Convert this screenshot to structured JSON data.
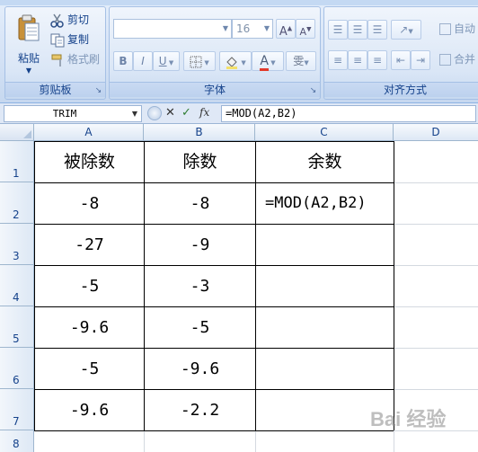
{
  "ribbon": {
    "clipboard": {
      "group_label": "剪贴板",
      "paste": "粘贴",
      "cut": "剪切",
      "copy": "复制",
      "format_painter": "格式刷"
    },
    "font": {
      "group_label": "字体",
      "font_name": "",
      "font_size": "16",
      "bold": "B",
      "italic": "I",
      "underline": "U",
      "font_color_glyph": "A",
      "phonetic_glyph": "雯"
    },
    "alignment": {
      "group_label": "对齐方式",
      "wrap_text": "自动",
      "merge_center": "合并"
    }
  },
  "formula_bar": {
    "name_box": "TRIM",
    "cancel": "✕",
    "enter": "✓",
    "fx": "fx",
    "formula": "=MOD(A2,B2)"
  },
  "grid": {
    "columns": [
      "A",
      "B",
      "C",
      "D"
    ],
    "rows": [
      "1",
      "2",
      "3",
      "4",
      "5",
      "6",
      "7",
      "8"
    ],
    "cells": [
      [
        "被除数",
        "除数",
        "余数"
      ],
      [
        "-8",
        "-8",
        "=MOD(A2,B2)"
      ],
      [
        "-27",
        "-9",
        ""
      ],
      [
        "-5",
        "-3",
        ""
      ],
      [
        "-9.6",
        "-5",
        ""
      ],
      [
        "-5",
        "-9.6",
        ""
      ],
      [
        "-9.6",
        "-2.2",
        ""
      ]
    ]
  },
  "watermark": {
    "text": "Bai 经验",
    "icon": "baidu-paw-icon"
  },
  "colors": {
    "ribbon_bg": "#d3e1f5",
    "ribbon_text": "#15428b",
    "header_bg": "#dde8f5",
    "gridline": "#d4d9e0",
    "table_border": "#000000"
  }
}
